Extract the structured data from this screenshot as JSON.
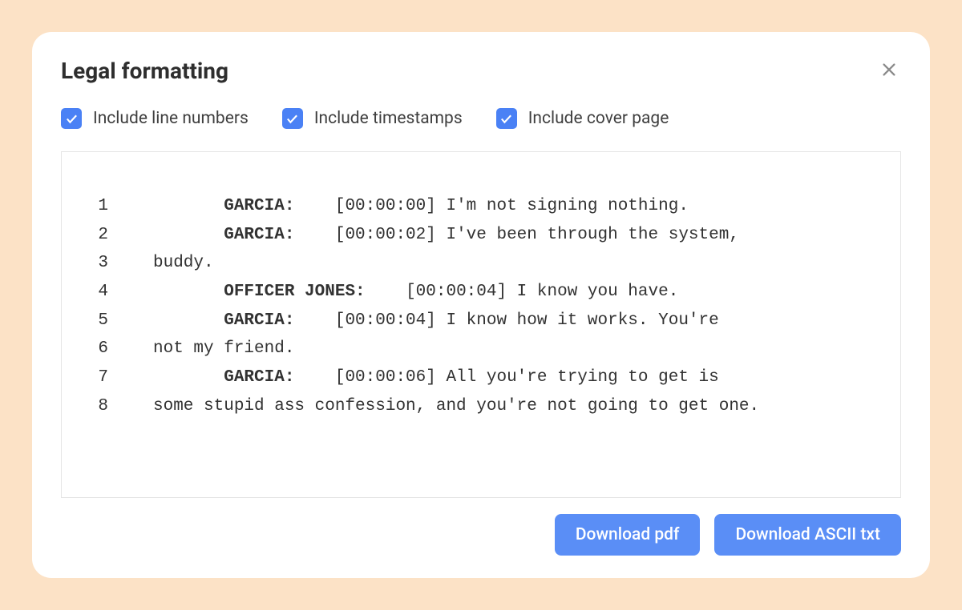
{
  "modal": {
    "title": "Legal formatting"
  },
  "options": {
    "line_numbers": {
      "label": "Include line numbers",
      "checked": true
    },
    "timestamps": {
      "label": "Include timestamps",
      "checked": true
    },
    "cover_page": {
      "label": "Include cover page",
      "checked": true
    }
  },
  "transcript": {
    "lines": [
      {
        "num": "1",
        "indent": "       ",
        "speaker": "GARCIA:",
        "post": "    [00:00:00] I'm not signing nothing."
      },
      {
        "num": "2",
        "indent": "       ",
        "speaker": "GARCIA:",
        "post": "    [00:00:02] I've been through the system,"
      },
      {
        "num": "3",
        "indent": "",
        "speaker": "",
        "post": "buddy."
      },
      {
        "num": "4",
        "indent": "       ",
        "speaker": "OFFICER JONES:",
        "post": "    [00:00:04] I know you have."
      },
      {
        "num": "5",
        "indent": "       ",
        "speaker": "GARCIA:",
        "post": "    [00:00:04] I know how it works. You're"
      },
      {
        "num": "6",
        "indent": "",
        "speaker": "",
        "post": "not my friend."
      },
      {
        "num": "7",
        "indent": "       ",
        "speaker": "GARCIA:",
        "post": "    [00:00:06] All you're trying to get is"
      },
      {
        "num": "8",
        "indent": "",
        "speaker": "",
        "post": "some stupid ass confession, and you're not going to get one."
      }
    ]
  },
  "footer": {
    "download_pdf": "Download pdf",
    "download_txt": "Download ASCII txt"
  }
}
